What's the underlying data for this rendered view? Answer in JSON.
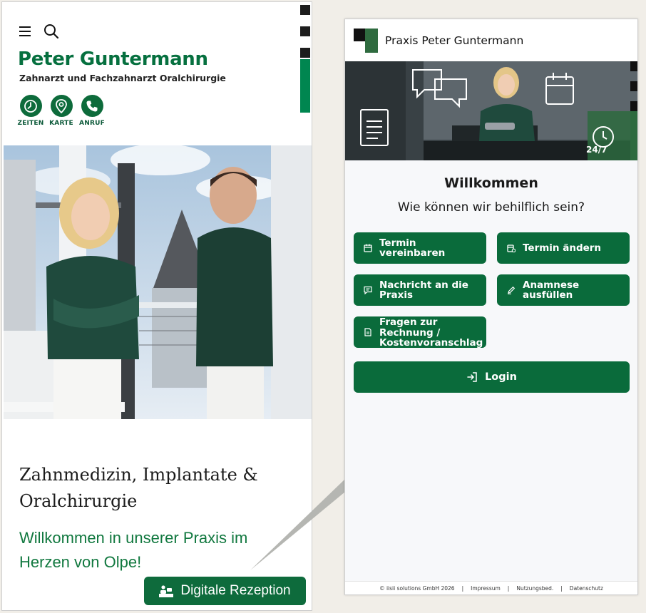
{
  "website": {
    "brand_name": "Peter Guntermann",
    "brand_subtitle": "Zahnarzt und Fachzahnarzt Oralchirurgie",
    "icons": {
      "menu": "hamburger-menu-icon",
      "search": "search-icon"
    },
    "quick_links": [
      {
        "label": "ZEITEN",
        "icon": "clock-icon"
      },
      {
        "label": "KARTE",
        "icon": "map-pin-icon"
      },
      {
        "label": "ANRUF",
        "icon": "phone-icon"
      }
    ],
    "headline": "Zahnmedizin, Implantate & Oralchirurgie",
    "welcome_text": "Willkommen in unserer Praxis im Herzen von Olpe!",
    "reception_button": "Digitale Rezeption",
    "colors": {
      "brand_green": "#06703f",
      "button_green": "#0e6b3c"
    }
  },
  "portal": {
    "title": "Praxis Peter Guntermann",
    "banner_badge": "24/7",
    "welcome": "Willkommen",
    "help_question": "Wie können wir behilflich sein?",
    "actions": [
      {
        "label": "Termin vereinbaren",
        "icon": "calendar-icon"
      },
      {
        "label": "Termin ändern",
        "icon": "calendar-edit-icon"
      },
      {
        "label": "Nachricht an die Praxis",
        "icon": "message-icon"
      },
      {
        "label": "Anamnese ausfüllen",
        "icon": "pen-icon"
      },
      {
        "label": "Fragen zur Rechnung / Kostenvoranschlag",
        "icon": "invoice-icon"
      }
    ],
    "login_label": "Login",
    "footer": {
      "copyright": "© iisii solutions GmbH 2026",
      "links": [
        "Impressum",
        "Nutzungsbed.",
        "Datenschutz"
      ]
    },
    "colors": {
      "button_green": "#0a6b3b",
      "background": "#f7f8fa"
    }
  }
}
